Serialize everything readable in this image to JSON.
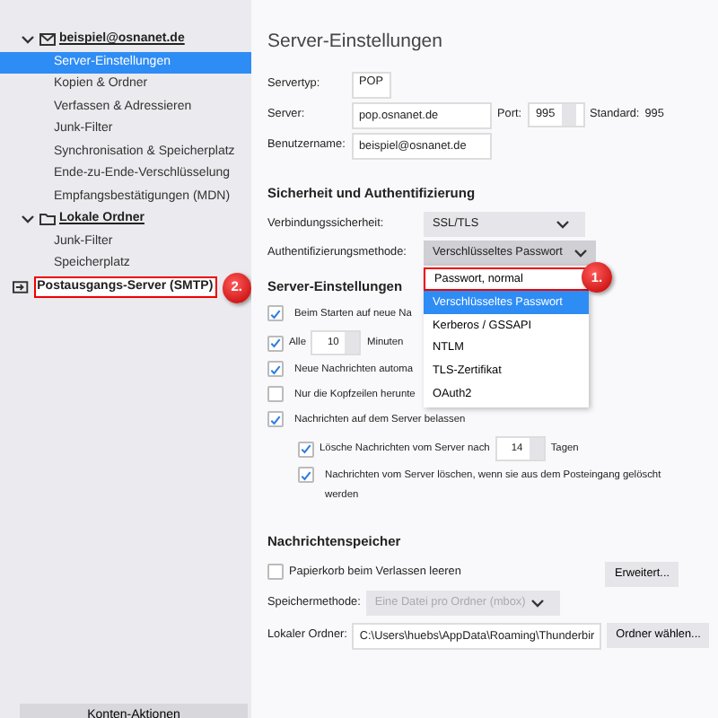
{
  "sidebar": {
    "accounts": [
      {
        "label": "beispiel@osnanet.de",
        "kind": "mail",
        "expanded": true,
        "children": [
          {
            "label": "Server-Einstellungen",
            "selected": true
          },
          {
            "label": "Kopien & Ordner",
            "selected": false
          },
          {
            "label": "Verfassen & Adressieren",
            "selected": false
          },
          {
            "label": "Junk-Filter",
            "selected": false
          },
          {
            "label": "Synchronisation & Speicherplatz",
            "selected": false
          },
          {
            "label": "Ende-zu-Ende-Verschlüsselung",
            "selected": false
          },
          {
            "label": "Empfangsbestätigungen (MDN)",
            "selected": false
          }
        ]
      },
      {
        "label": "Lokale Ordner",
        "kind": "folder",
        "expanded": true,
        "children": [
          {
            "label": "Junk-Filter",
            "selected": false
          },
          {
            "label": "Speicherplatz",
            "selected": false
          }
        ]
      },
      {
        "label": "Postausgangs-Server (SMTP)",
        "kind": "outbox",
        "callout": "2."
      }
    ],
    "actions_button": "Konten-Aktionen"
  },
  "title": "Server-Einstellungen",
  "server": {
    "type_label": "Servertyp:",
    "type_value": "POP",
    "server_label": "Server:",
    "server_value": "pop.osnanet.de",
    "port_label": "Port:",
    "port_value": "995",
    "default_label": "Standard:",
    "default_value": "995",
    "user_label": "Benutzername:",
    "user_value": "beispiel@osnanet.de"
  },
  "security": {
    "heading": "Sicherheit und Authentifizierung",
    "connection_label": "Verbindungssicherheit:",
    "connection_value": "SSL/TLS",
    "auth_label": "Authentifizierungsmethode:",
    "auth_value": "Verschlüsseltes Passwort",
    "auth_open": true,
    "auth_options": [
      {
        "label": "Passwort, normal",
        "selected": false,
        "callout": "1."
      },
      {
        "label": "Verschlüsseltes Passwort",
        "selected": true
      },
      {
        "label": "Kerberos / GSSAPI",
        "selected": false
      },
      {
        "label": "NTLM",
        "selected": false
      },
      {
        "label": "TLS-Zertifikat",
        "selected": false
      },
      {
        "label": "OAuth2",
        "selected": false
      }
    ]
  },
  "server_settings": {
    "heading": "Server-Einstellungen",
    "options": [
      {
        "kind": "plain",
        "label": "Beim Starten auf neue Na",
        "checked": true
      },
      {
        "kind": "interval",
        "label": "Alle",
        "value": "10",
        "suffix": "Minuten",
        "checked": true
      },
      {
        "kind": "plain",
        "label": "Neue Nachrichten automa",
        "checked": true
      },
      {
        "kind": "plain",
        "label": "Nur die Kopfzeilen herunte",
        "checked": false
      },
      {
        "kind": "plain",
        "label": "Nachrichten auf dem Server belassen",
        "checked": true,
        "children": [
          {
            "kind": "interval",
            "label": "Lösche Nachrichten vom Server nach",
            "value": "14",
            "suffix": "Tagen",
            "checked": true
          },
          {
            "kind": "plain",
            "label": "Nachrichten vom Server löschen, wenn sie aus dem Posteingang gelöscht werden",
            "checked": true
          }
        ]
      }
    ]
  },
  "storage": {
    "heading": "Nachrichtenspeicher",
    "empty_trash_label": "Papierkorb beim Verlassen leeren",
    "empty_trash_checked": false,
    "advanced_button": "Erweitert...",
    "method_label": "Speichermethode:",
    "method_value": "Eine Datei pro Ordner (mbox)",
    "method_disabled": true,
    "folder_label": "Lokaler Ordner:",
    "folder_value": "C:\\Users\\huebs\\AppData\\Roaming\\Thunderbir",
    "choose_button": "Ordner wählen..."
  }
}
